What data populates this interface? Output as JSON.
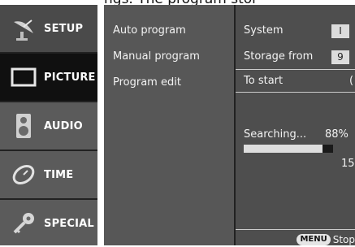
{
  "top_caption": "ngs. The program stor",
  "sidebar": {
    "items": [
      {
        "label": "SETUP",
        "icon": "satellite-dish-icon"
      },
      {
        "label": "PICTURE",
        "icon": "tv-screen-icon"
      },
      {
        "label": "AUDIO",
        "icon": "speaker-icon"
      },
      {
        "label": "TIME",
        "icon": "clock-icon"
      },
      {
        "label": "SPECIAL",
        "icon": "key-icon"
      }
    ]
  },
  "menu": {
    "items": [
      "Auto program",
      "Manual program",
      "Program edit"
    ]
  },
  "detail": {
    "system_label": "System",
    "system_value": "I",
    "storage_label": "Storage from",
    "storage_value": "9",
    "to_start_label": "To start",
    "to_start_value": "(",
    "searching_label": "Searching...",
    "progress_text": "88%",
    "progress_fraction": 0.88,
    "count": "15",
    "footer_key": "MENU",
    "footer_label": "Stop"
  },
  "colors": {
    "sidebar_bg": "#5b5b5b",
    "menu_bg": "#575757",
    "detail_bg": "#4e4e4e",
    "progress_fill": "#dedede"
  }
}
